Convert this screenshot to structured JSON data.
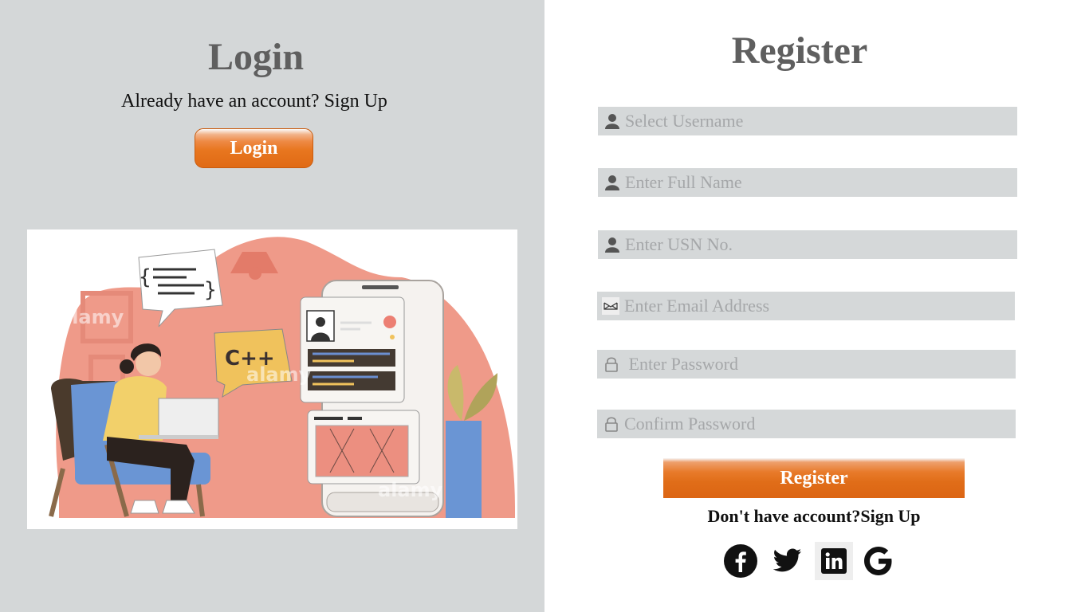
{
  "login_panel": {
    "title": "Login",
    "subtitle": "Already have an account? Sign Up",
    "button_label": "Login",
    "illustration_watermark": "alamy",
    "illustration_badge": "C++"
  },
  "register_panel": {
    "title": "Register",
    "fields": [
      {
        "placeholder": "Select Username",
        "icon": "user-icon",
        "type": "text"
      },
      {
        "placeholder": "Enter Full Name",
        "icon": "user-icon",
        "type": "text"
      },
      {
        "placeholder": "Enter USN No.",
        "icon": "user-icon",
        "type": "text"
      },
      {
        "placeholder": "Enter Email Address",
        "icon": "envelope-icon",
        "type": "email"
      },
      {
        "placeholder": " Enter Password",
        "icon": "lock-icon",
        "type": "password"
      },
      {
        "placeholder": "Confirm Password",
        "icon": "lock-icon",
        "type": "password"
      }
    ],
    "button_label": "Register",
    "footer_text": "Don't have account?Sign Up",
    "social": [
      "facebook-icon",
      "twitter-icon",
      "linkedin-icon",
      "google-icon"
    ]
  },
  "colors": {
    "left_bg": "#d4d7d8",
    "field_bg": "#d5d8d9",
    "accent_orange": "#e8761f",
    "title_gray": "#5f5f5f",
    "placeholder_gray": "#a5a7a9"
  }
}
